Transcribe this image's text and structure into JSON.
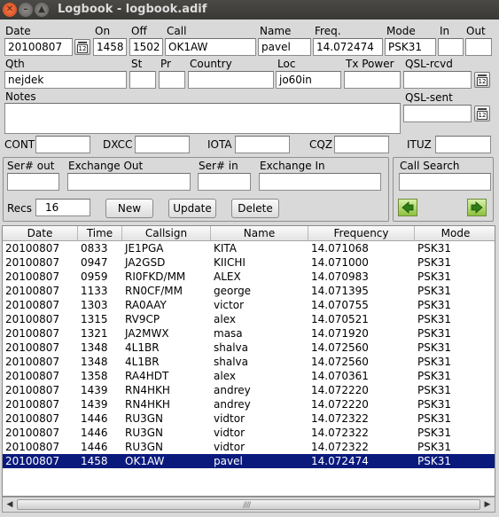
{
  "window": {
    "title": "Logbook - logbook.adif"
  },
  "labels": {
    "date": "Date",
    "on": "On",
    "off": "Off",
    "call": "Call",
    "name": "Name",
    "freq": "Freq.",
    "mode": "Mode",
    "in": "In",
    "out": "Out",
    "qth": "Qth",
    "st": "St",
    "pr": "Pr",
    "country": "Country",
    "loc": "Loc",
    "tx_power": "Tx Power",
    "qsl_rcvd": "QSL-rcvd",
    "notes": "Notes",
    "qsl_sent": "QSL-sent",
    "cont": "CONT",
    "dxcc": "DXCC",
    "iota": "IOTA",
    "cqz": "CQZ",
    "ituz": "ITUZ",
    "ser_out": "Ser# out",
    "exchange_out": "Exchange Out",
    "ser_in": "Ser# in",
    "exchange_in": "Exchange In",
    "call_search": "Call Search",
    "recs": "Recs"
  },
  "fields": {
    "date": "20100807",
    "on": "1458",
    "off": "1502",
    "call": "OK1AW",
    "name": "pavel",
    "freq": "14.072474",
    "mode": "PSK31",
    "in": "",
    "out": "",
    "qth": "nejdek",
    "st": "",
    "pr": "",
    "country": "",
    "loc": "jo60in",
    "tx_power": "",
    "qsl_rcvd": "",
    "notes": "",
    "qsl_sent": "",
    "cont": "",
    "dxcc": "",
    "iota": "",
    "cqz": "",
    "ituz": "",
    "ser_out": "",
    "exchange_out": "",
    "ser_in": "",
    "exchange_in": "",
    "call_search": "",
    "recs": "16"
  },
  "calendar_glyph": "12",
  "buttons": {
    "new": "New",
    "update": "Update",
    "delete": "Delete"
  },
  "icons": {
    "prev": "left-arrow-icon",
    "next": "right-arrow-icon",
    "calendar": "calendar-icon"
  },
  "colors": {
    "selection": "#0a1a7c",
    "arrow_green": "#8cc23d"
  },
  "table": {
    "headers": [
      "Date",
      "Time",
      "Callsign",
      "Name",
      "Frequency",
      "Mode"
    ],
    "rows": [
      [
        "20100807",
        "0833",
        "JE1PGA",
        "KITA",
        "14.071068",
        "PSK31"
      ],
      [
        "20100807",
        "0947",
        "JA2GSD",
        "KIICHI",
        "14.071000",
        "PSK31"
      ],
      [
        "20100807",
        "0959",
        "RI0FKD/MM",
        "ALEX",
        "14.070983",
        "PSK31"
      ],
      [
        "20100807",
        "1133",
        "RN0CF/MM",
        "george",
        "14.071395",
        "PSK31"
      ],
      [
        "20100807",
        "1303",
        "RA0AAY",
        "victor",
        "14.070755",
        "PSK31"
      ],
      [
        "20100807",
        "1315",
        "RV9CP",
        "alex",
        "14.070521",
        "PSK31"
      ],
      [
        "20100807",
        "1321",
        "JA2MWX",
        "masa",
        "14.071920",
        "PSK31"
      ],
      [
        "20100807",
        "1348",
        "4L1BR",
        "shalva",
        "14.072560",
        "PSK31"
      ],
      [
        "20100807",
        "1348",
        "4L1BR",
        "shalva",
        "14.072560",
        "PSK31"
      ],
      [
        "20100807",
        "1358",
        "RA4HDT",
        "alex",
        "14.070361",
        "PSK31"
      ],
      [
        "20100807",
        "1439",
        "RN4HKH",
        "andrey",
        "14.072220",
        "PSK31"
      ],
      [
        "20100807",
        "1439",
        "RN4HKH",
        "andrey",
        "14.072220",
        "PSK31"
      ],
      [
        "20100807",
        "1446",
        "RU3GN",
        "vidtor",
        "14.072322",
        "PSK31"
      ],
      [
        "20100807",
        "1446",
        "RU3GN",
        "vidtor",
        "14.072322",
        "PSK31"
      ],
      [
        "20100807",
        "1446",
        "RU3GN",
        "vidtor",
        "14.072322",
        "PSK31"
      ],
      [
        "20100807",
        "1458",
        "OK1AW",
        "pavel",
        "14.072474",
        "PSK31"
      ]
    ],
    "selected_row": 15
  }
}
